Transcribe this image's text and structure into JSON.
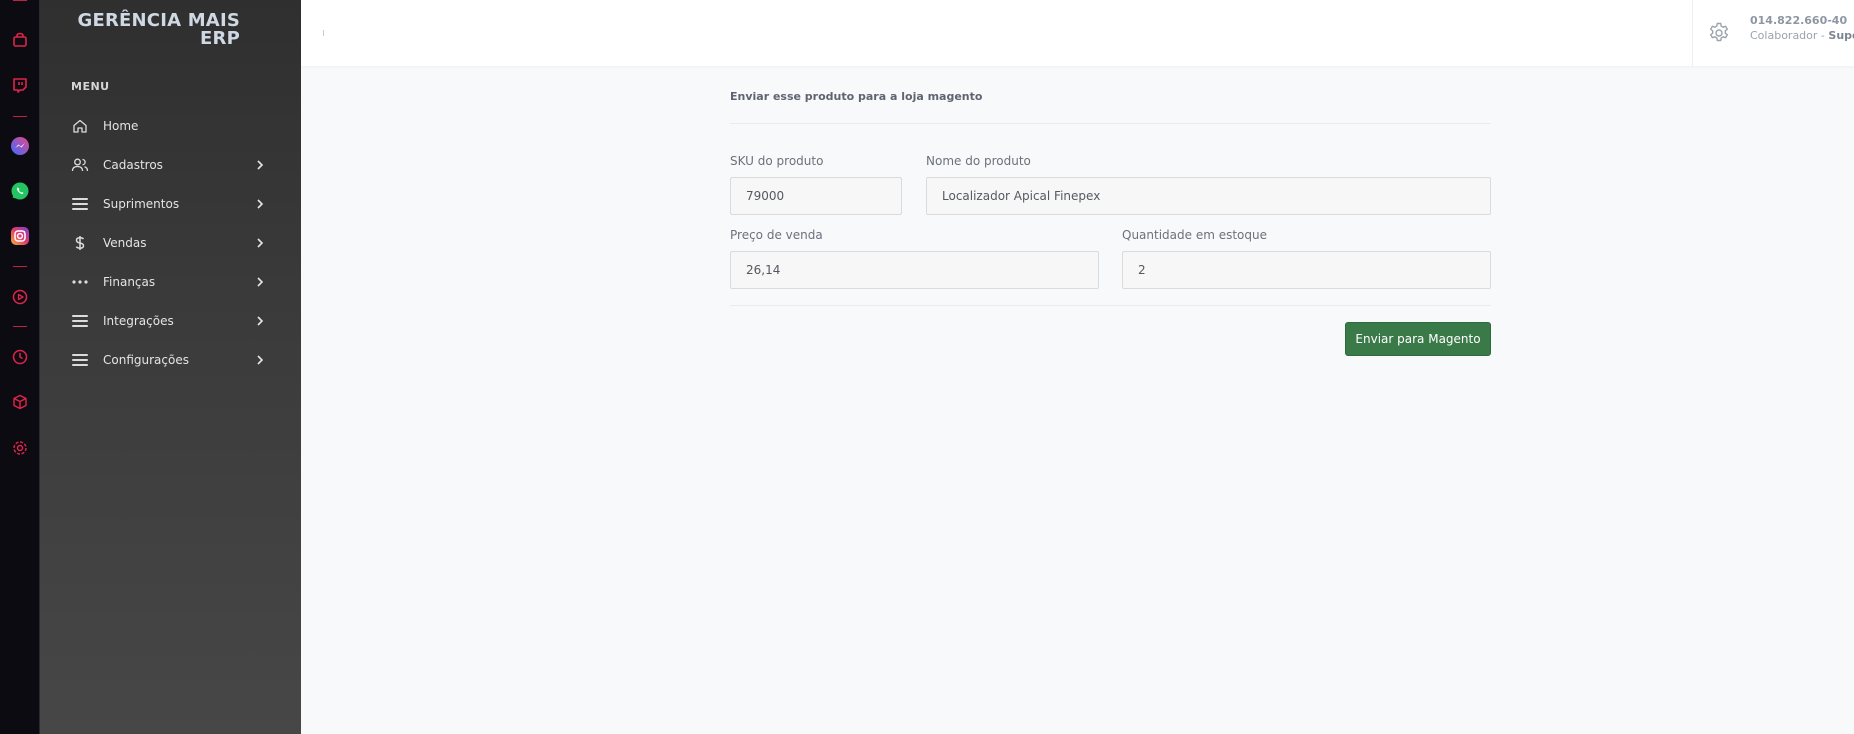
{
  "app": {
    "brand": "GERÊNCIA MAIS ERP",
    "menu_heading": "MENU"
  },
  "sidebar": {
    "items": [
      {
        "label": "Home",
        "icon": "home-icon",
        "has_submenu": false
      },
      {
        "label": "Cadastros",
        "icon": "users-icon",
        "has_submenu": true
      },
      {
        "label": "Suprimentos",
        "icon": "list-icon",
        "has_submenu": true
      },
      {
        "label": "Vendas",
        "icon": "dollar-icon",
        "has_submenu": true
      },
      {
        "label": "Finanças",
        "icon": "dots-icon",
        "has_submenu": true
      },
      {
        "label": "Integrações",
        "icon": "list-icon",
        "has_submenu": true
      },
      {
        "label": "Configurações",
        "icon": "list-icon",
        "has_submenu": true
      }
    ]
  },
  "browser_sidebar": {
    "icons": [
      "bag-icon",
      "twitch-icon",
      "messenger-icon",
      "whatsapp-icon",
      "instagram-icon",
      "play-icon",
      "clock-icon",
      "box-icon",
      "settings-icon"
    ],
    "accent_color": "#e0244a"
  },
  "header": {
    "user_id": "014.822.660-40",
    "role_prefix": "Colaborador - ",
    "role_name": "Supo"
  },
  "form": {
    "title": "Enviar esse produto para a loja magento",
    "sku_label": "SKU do produto",
    "sku_value": "79000",
    "name_label": "Nome do produto",
    "name_value": "Localizador Apical Finepex",
    "price_label": "Preço de venda",
    "price_value": "26,14",
    "stock_label": "Quantidade em estoque",
    "stock_value": "2",
    "submit_label": "Enviar para Magento"
  },
  "colors": {
    "primary_button": "#3a7a49",
    "sidebar_bg": "#3a3a3a",
    "browser_bar_bg": "#0b0b11"
  }
}
